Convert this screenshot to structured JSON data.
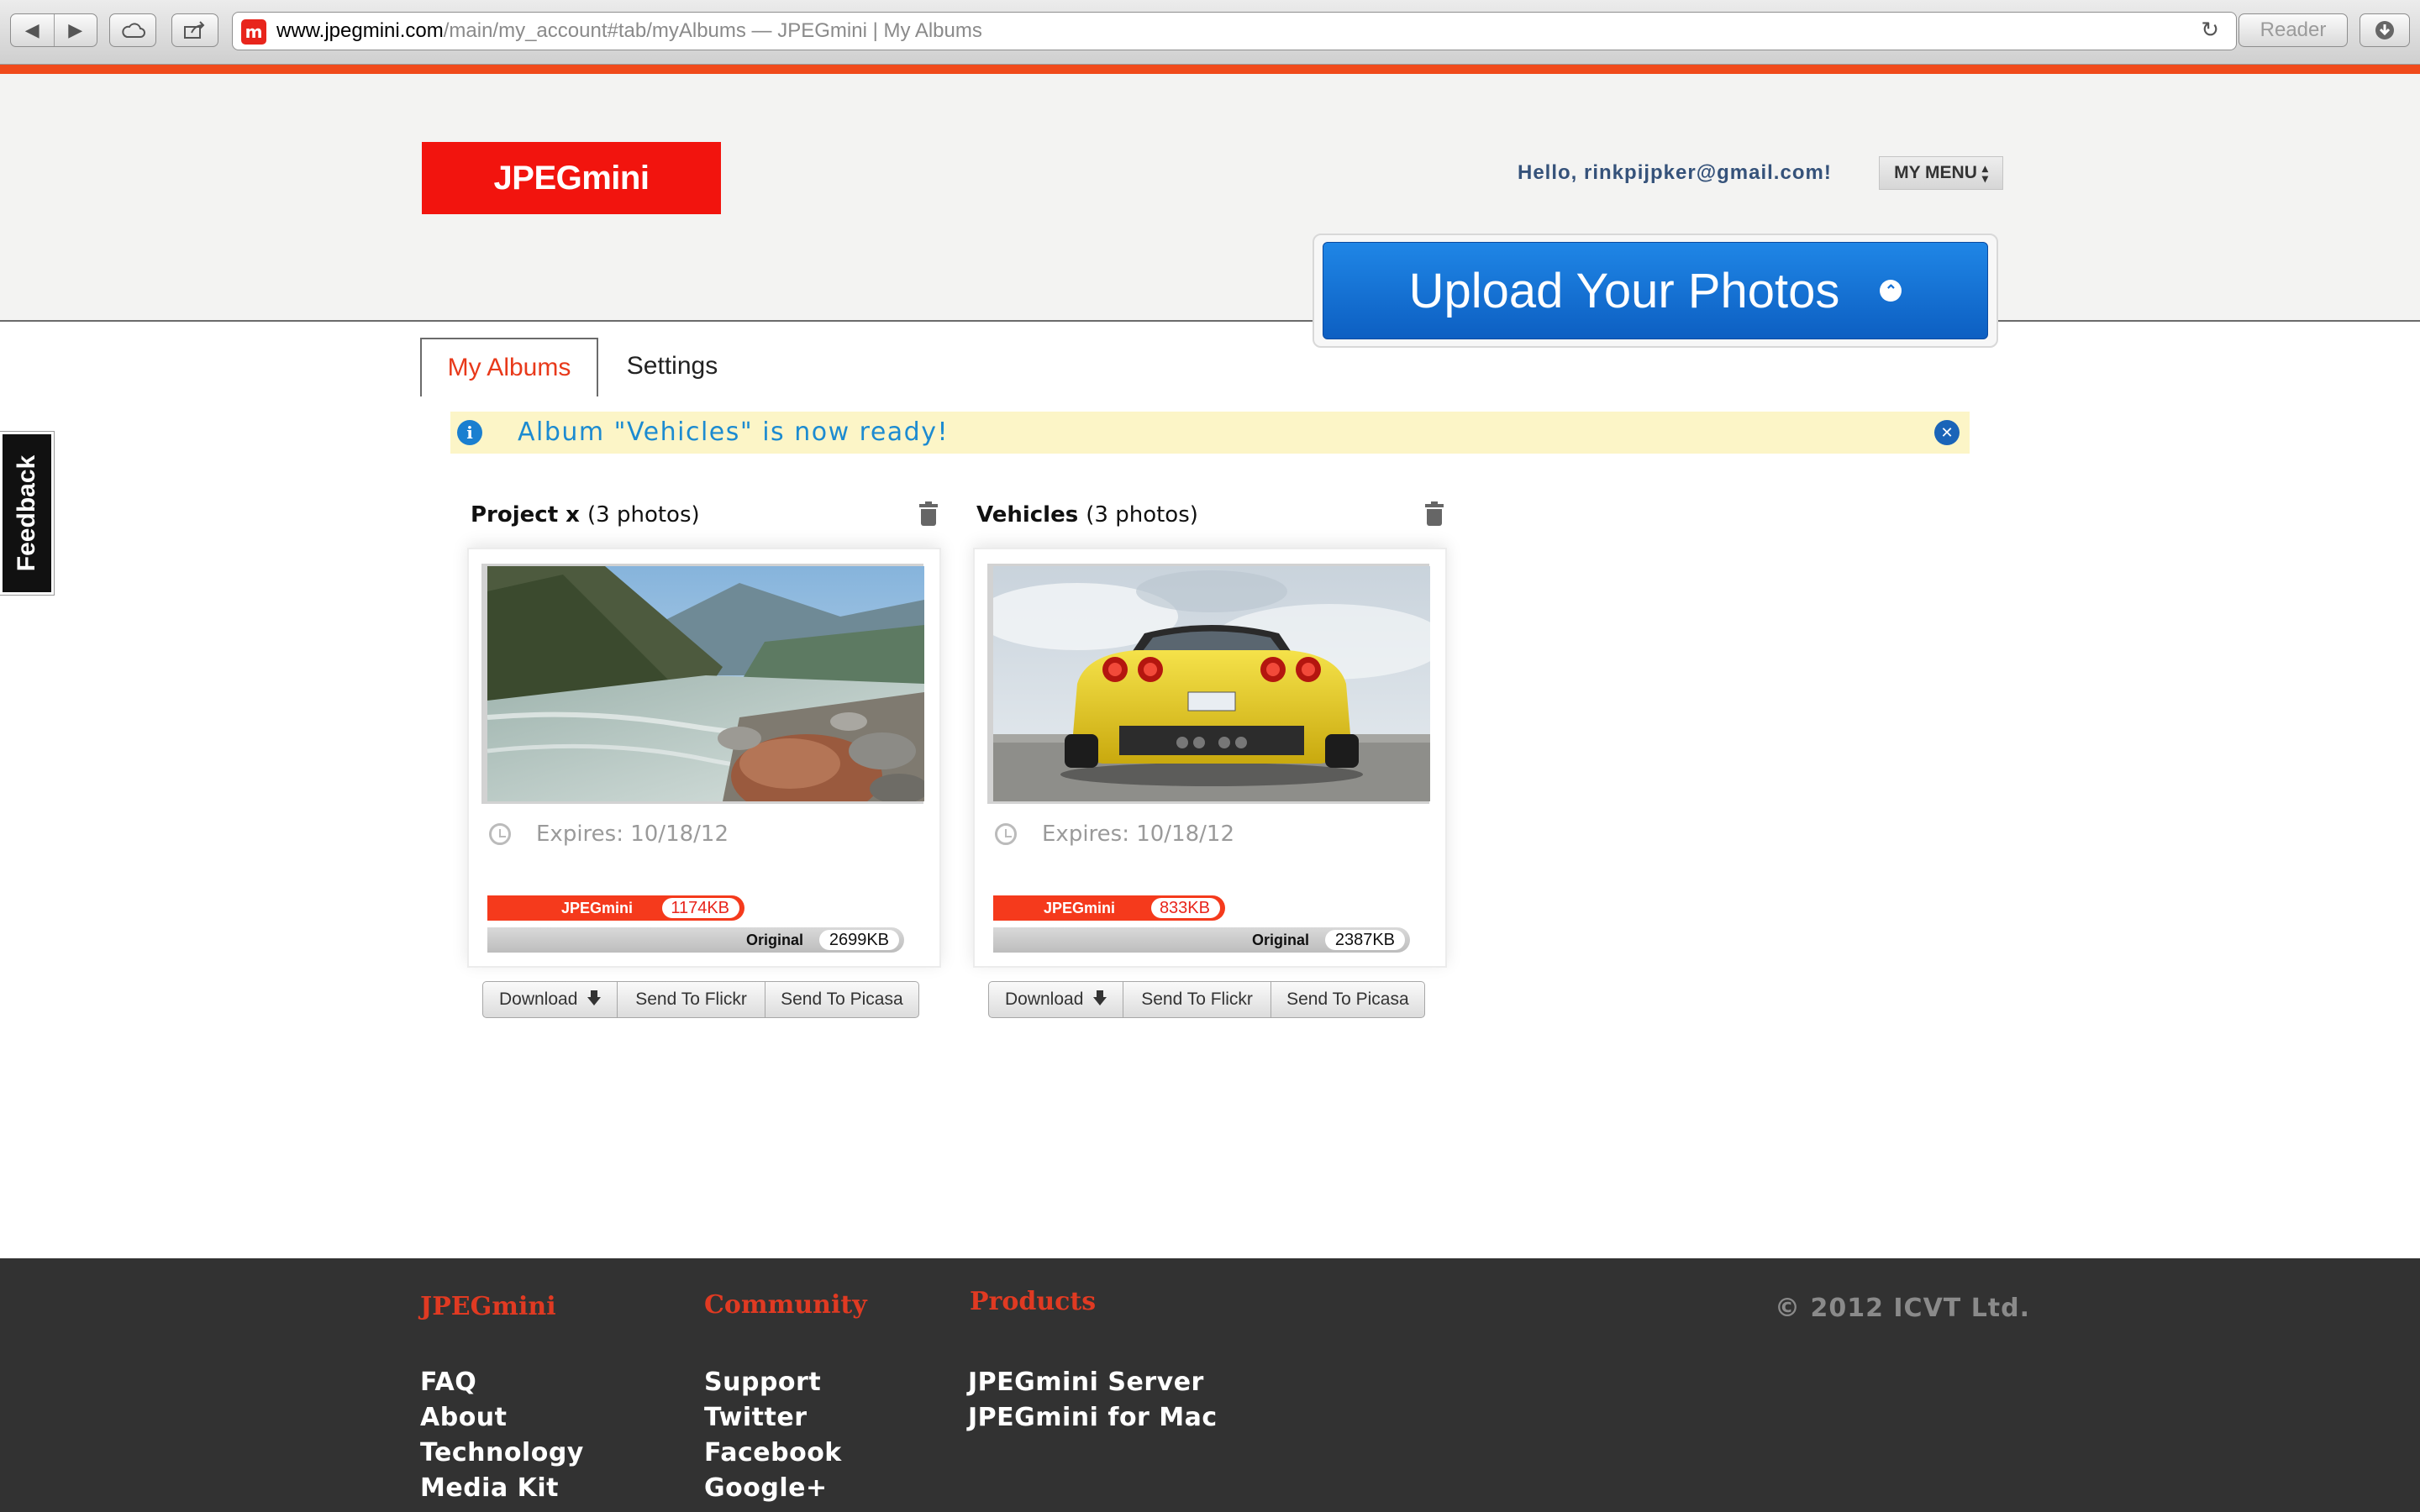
{
  "browser": {
    "url_host": "www.jpegmini.com",
    "url_path": "/main/my_account#tab/myAlbums",
    "page_title": " — JPEGmini | My Albums",
    "reader_label": "Reader"
  },
  "header": {
    "logo_text": "JPEGmini",
    "greeting": "Hello, rinkpijpker@gmail.com!",
    "menu_label": "MY MENU",
    "upload_label": "Upload Your Photos",
    "tabs": [
      {
        "label": "My Albums",
        "active": true
      },
      {
        "label": "Settings",
        "active": false
      }
    ]
  },
  "feedback_label": "Feedback",
  "notice": {
    "text": "Album \"Vehicles\" is now ready!"
  },
  "albums": [
    {
      "name": "Project x",
      "count_text": "(3 photos)",
      "expires": "Expires: 10/18/12",
      "mini_label": "JPEGmini",
      "mini_size": "1174KB",
      "orig_label": "Original",
      "orig_size": "2699KB",
      "photo": "mountain river with rocks",
      "buttons": {
        "download": "Download",
        "flickr": "Send To Flickr",
        "picasa": "Send To Picasa"
      }
    },
    {
      "name": "Vehicles",
      "count_text": "(3 photos)",
      "expires": "Expires: 10/18/12",
      "mini_label": "JPEGmini",
      "mini_size": "833KB",
      "orig_label": "Original",
      "orig_size": "2387KB",
      "photo": "yellow sports car rear view",
      "buttons": {
        "download": "Download",
        "flickr": "Send To Flickr",
        "picasa": "Send To Picasa"
      }
    }
  ],
  "footer": {
    "columns": [
      {
        "title": "JPEGmini",
        "links": [
          "FAQ",
          "About",
          "Technology",
          "Media Kit"
        ]
      },
      {
        "title": "Community",
        "links": [
          "Support",
          "Twitter",
          "Facebook",
          "Google+"
        ]
      },
      {
        "title": "Products",
        "links": [
          "JPEGmini Server",
          "JPEGmini for Mac"
        ]
      }
    ],
    "copyright": "© 2012 ICVT Ltd."
  },
  "colors": {
    "brand_red": "#f2140e",
    "accent_orange": "#f04a1b",
    "upload_blue": "#1470d6",
    "notice_bg": "#fcf5c7",
    "footer_bg": "#323232"
  }
}
